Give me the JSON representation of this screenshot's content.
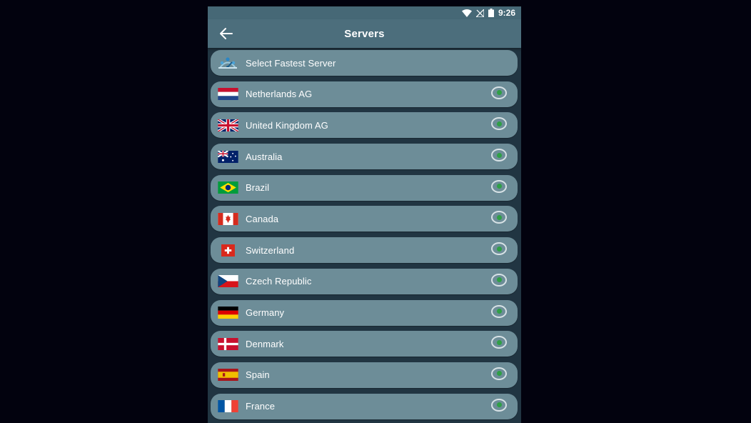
{
  "status": {
    "time": "9:26"
  },
  "header": {
    "title": "Servers"
  },
  "fastest": {
    "label": "Select Fastest Server"
  },
  "servers": [
    {
      "name": "Netherlands AG",
      "flag": "netherlands-flag-icon"
    },
    {
      "name": "United Kingdom AG",
      "flag": "united-kingdom-flag-icon"
    },
    {
      "name": "Australia",
      "flag": "australia-flag-icon"
    },
    {
      "name": "Brazil",
      "flag": "brazil-flag-icon"
    },
    {
      "name": "Canada",
      "flag": "canada-flag-icon"
    },
    {
      "name": "Switzerland",
      "flag": "switzerland-flag-icon"
    },
    {
      "name": "Czech Republic",
      "flag": "czech-republic-flag-icon"
    },
    {
      "name": "Germany",
      "flag": "germany-flag-icon"
    },
    {
      "name": "Denmark",
      "flag": "denmark-flag-icon"
    },
    {
      "name": "Spain",
      "flag": "spain-flag-icon"
    },
    {
      "name": "France",
      "flag": "france-flag-icon"
    }
  ],
  "colors": {
    "background": "#02020e",
    "appbar": "#4c6e7c",
    "row": "#6d8d98",
    "radio_dot": "#2fa045"
  }
}
